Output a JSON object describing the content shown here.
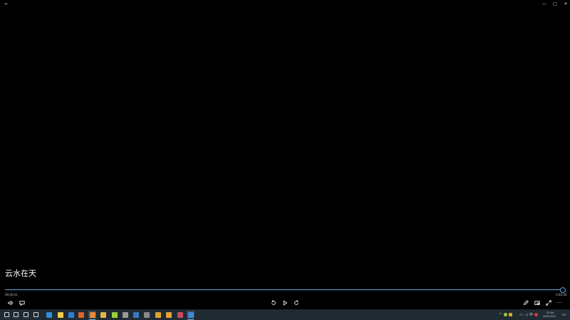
{
  "player": {
    "title": "云水在天",
    "time_elapsed": "00:00:21",
    "time_remaining": "0:00:00",
    "progress": 1.0
  },
  "window_controls": {
    "back_icon": "arrow-left-icon",
    "minimize_icon": "minimize-icon",
    "maximize_icon": "maximize-icon",
    "close_icon": "close-icon"
  },
  "controls": {
    "left": [
      "volume-icon",
      "subtitles-icon"
    ],
    "center": [
      "skip-back-10-icon",
      "play-icon",
      "skip-forward-30-icon"
    ],
    "right": [
      "edit-pen-icon",
      "mini-view-icon",
      "fullscreen-icon",
      "more-icon"
    ]
  },
  "taskbar": {
    "apps": [
      {
        "name": "start",
        "color": "#d8d8d8"
      },
      {
        "name": "search",
        "color": "#d8d8d8"
      },
      {
        "name": "cortana",
        "color": "#d8d8d8"
      },
      {
        "name": "task-view",
        "color": "#d8d8d8"
      },
      {
        "name": "edge",
        "color": "#2d8fd8"
      },
      {
        "name": "file-explorer",
        "color": "#f1c94e"
      },
      {
        "name": "mail",
        "color": "#2b7cd3"
      },
      {
        "name": "store",
        "color": "#e0622d"
      },
      {
        "name": "photos",
        "color": "#e98a3a"
      },
      {
        "name": "folder",
        "color": "#e1b54a"
      },
      {
        "name": "chrome",
        "color": "#9bcf3a"
      },
      {
        "name": "settings",
        "color": "#999999"
      },
      {
        "name": "word",
        "color": "#3a78c4"
      },
      {
        "name": "app-gray",
        "color": "#8a8a8a"
      },
      {
        "name": "app-yellow",
        "color": "#d9a32c"
      },
      {
        "name": "app-orange",
        "color": "#e8a033"
      },
      {
        "name": "app-circle",
        "color": "#c84a5d"
      },
      {
        "name": "movies-tv",
        "color": "#3f8ad6"
      }
    ],
    "clock_time": "22:00",
    "clock_date": "2021/7/22"
  }
}
